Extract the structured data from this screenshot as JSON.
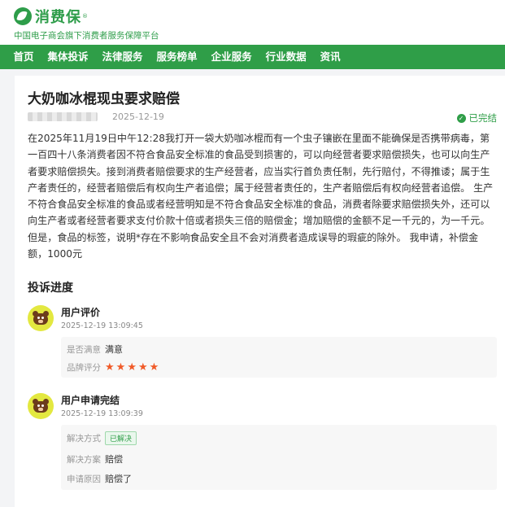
{
  "header": {
    "logo_text": "消费保",
    "logo_reg": "®",
    "subtitle": "中国电子商会旗下消费者服务保障平台",
    "brand_color": "#2f9e48"
  },
  "nav": {
    "items": [
      "首页",
      "集体投诉",
      "法律服务",
      "服务榜单",
      "企业服务",
      "行业数据",
      "资讯"
    ],
    "active_index": 0
  },
  "complaint": {
    "title": "大奶咖冰棍现虫要求赔偿",
    "date": "2025-12-19",
    "status": "已完结",
    "body": "在2025年11月19日中午12:28我打开一袋大奶咖冰棍而有一个虫子镶嵌在里面不能确保是否携带病毒，第一百四十八条消费者因不符合食品安全标准的食品受到损害的，可以向经营者要求赔偿损失，也可以向生产者要求赔偿损失。接到消费者赔偿要求的生产经营者，应当实行首负责任制，先行赔付，不得推诿；属于生产者责任的，经营者赔偿后有权向生产者追偿；属于经营者责任的，生产者赔偿后有权向经营者追偿。 生产不符合食品安全标准的食品或者经营明知是不符合食品安全标准的食品，消费者除要求赔偿损失外，还可以向生产者或者经营者要求支付价款十倍或者损失三倍的赔偿金；增加赔偿的金额不足一千元的，为一千元。但是，食品的标签，说明*存在不影响食品安全且不会对消费者造成误导的瑕疵的除外。 我申请，补偿金额，1000元"
  },
  "progress": {
    "title": "投诉进度",
    "events": [
      {
        "name": "用户评价",
        "time": "2025-12-19 13:09:45",
        "satisfied_label": "是否满意",
        "satisfied_value": "满意",
        "rating_label": "品牌评分",
        "rating": 5
      },
      {
        "name": "用户申请完结",
        "time": "2025-12-19 13:09:39",
        "method_label": "解决方式",
        "method_value": "已解决",
        "plan_label": "解决方案",
        "plan_value": "赔偿",
        "reason_label": "申请原因",
        "reason_value": "赔偿了"
      }
    ]
  }
}
